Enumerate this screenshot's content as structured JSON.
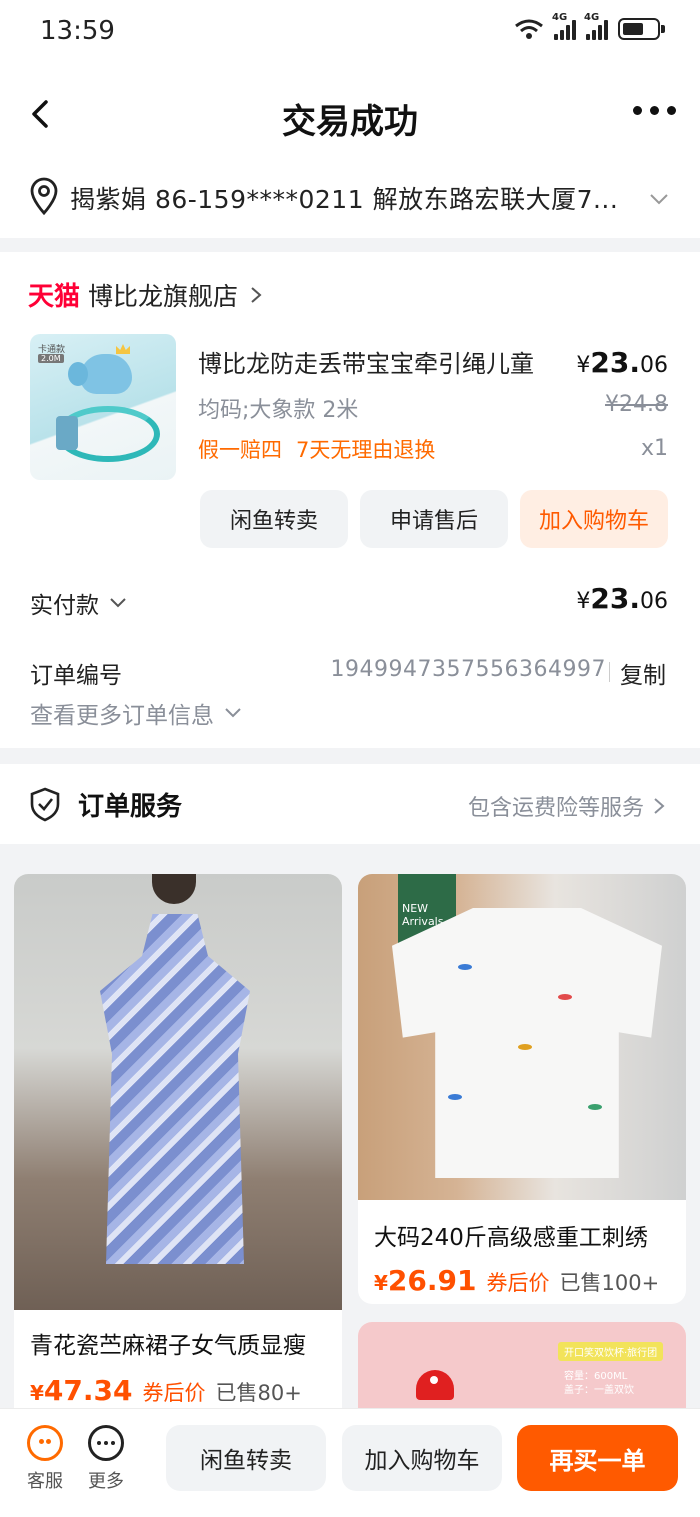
{
  "status": {
    "time": "13:59",
    "net1": "4G",
    "net2": "4G"
  },
  "nav": {
    "title": "交易成功"
  },
  "address": {
    "text": "揭紫娟  86-159****0211  解放东路宏联大厦7..."
  },
  "shop": {
    "platform": "天猫",
    "name": "博比龙旗舰店"
  },
  "product": {
    "thumb_badge": "卡通款",
    "thumb_badge2": "2.0M",
    "name": "博比龙防走丢带宝宝牵引绳儿童",
    "spec": "均码;大象款 2米",
    "tags": [
      "假一赔四",
      "7天无理由退换"
    ],
    "price_symbol": "¥",
    "price_int": "23.",
    "price_dec": "06",
    "orig_price": "¥24.8",
    "qty": "x1"
  },
  "actions": {
    "resell": "闲鱼转卖",
    "after_sale": "申请售后",
    "add_cart": "加入购物车"
  },
  "payment": {
    "label": "实付款",
    "symbol": "¥",
    "int": "23.",
    "dec": "06"
  },
  "order": {
    "label": "订单编号",
    "number": "1949947357556364997",
    "copy": "复制",
    "more": "查看更多订单信息"
  },
  "service": {
    "title": "订单服务",
    "info": "包含运费险等服务"
  },
  "feed": [
    {
      "title": "青花瓷苎麻裙子女气质显瘦",
      "cur": "¥",
      "price": "47.34",
      "coupon": "券后价",
      "sold": "已售80+"
    },
    {
      "title": "大码240斤高级感重工刺绣",
      "cur": "¥",
      "price": "26.91",
      "coupon": "券后价",
      "sold": "已售100+",
      "sign": "NEW Arrivals"
    },
    {
      "label": "开口笑双饮杯·旅行团",
      "spec1": "容量：600ML",
      "spec2": "盖子：一盖双饮"
    }
  ],
  "bottom": {
    "cs": "客服",
    "more": "更多",
    "resell": "闲鱼转卖",
    "add_cart": "加入购物车",
    "rebuy": "再买一单"
  },
  "colors": {
    "accent": "#ff5a00",
    "tmall": "#ff0036",
    "muted": "#8a8f99"
  },
  "icons": [
    "back-icon",
    "more-icon",
    "location-pin-icon",
    "chevron-down-icon",
    "chevron-right-icon",
    "shield-icon",
    "customer-service-icon",
    "more-circle-icon"
  ]
}
